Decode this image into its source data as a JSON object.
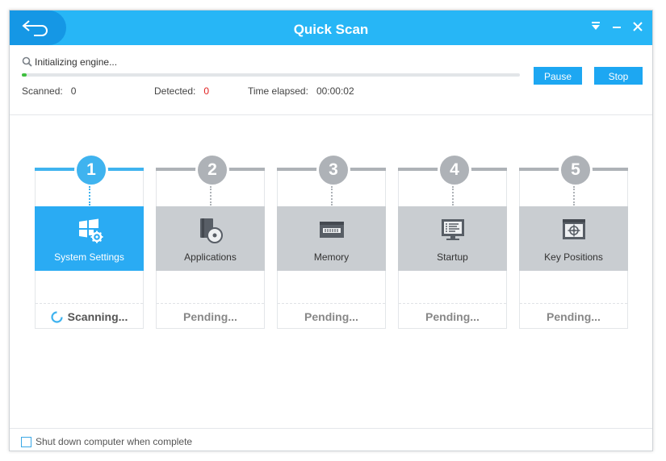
{
  "window": {
    "title": "Quick Scan",
    "controls": [
      "dropdown-icon",
      "minimize-icon",
      "close-icon"
    ]
  },
  "status": {
    "message": "Initializing engine...",
    "progress_percent": 1,
    "scanned_label": "Scanned:",
    "scanned_value": "0",
    "detected_label": "Detected:",
    "detected_value": "0",
    "elapsed_label": "Time elapsed:",
    "elapsed_value": "00:00:02",
    "pause_label": "Pause",
    "stop_label": "Stop"
  },
  "steps": [
    {
      "number": "1",
      "label": "System Settings",
      "state": "Scanning...",
      "icon": "windows-settings-icon",
      "active": true
    },
    {
      "number": "2",
      "label": "Applications",
      "state": "Pending...",
      "icon": "applications-icon",
      "active": false
    },
    {
      "number": "3",
      "label": "Memory",
      "state": "Pending...",
      "icon": "memory-icon",
      "active": false
    },
    {
      "number": "4",
      "label": "Startup",
      "state": "Pending...",
      "icon": "startup-icon",
      "active": false
    },
    {
      "number": "5",
      "label": "Key Positions",
      "state": "Pending...",
      "icon": "key-positions-icon",
      "active": false
    }
  ],
  "footer": {
    "shutdown_label": "Shut down computer when complete",
    "shutdown_checked": false
  },
  "colors": {
    "accent": "#27b6f6",
    "active_step": "#2aabf3",
    "inactive_step": "#c9cdd1",
    "progress": "#3fbf3f",
    "detected": "#e02020"
  }
}
